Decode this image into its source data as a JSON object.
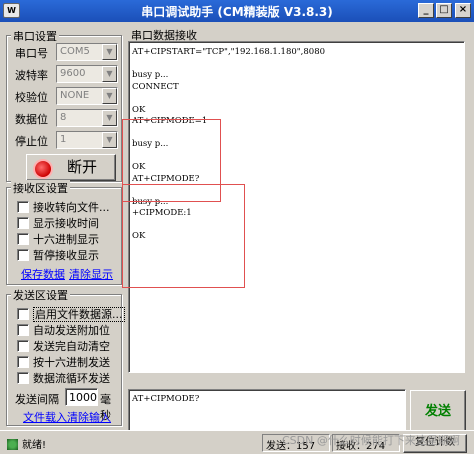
{
  "window": {
    "title": "串口调试助手 (CM精装版 V3.8.3)",
    "icon_label": "W",
    "minimize_glyph": "_",
    "maximize_glyph": "□",
    "close_glyph": "×"
  },
  "serial_settings": {
    "title": "串口设置",
    "port_label": "串口号",
    "port_value": "COM5",
    "baud_label": "波特率",
    "baud_value": "9600",
    "parity_label": "校验位",
    "parity_value": "NONE",
    "databits_label": "数据位",
    "databits_value": "8",
    "stopbits_label": "停止位",
    "stopbits_value": "1",
    "open_button": "断开",
    "dropdown_glyph": "▼"
  },
  "receive_settings": {
    "title": "接收区设置",
    "options": [
      "接收转向文件...",
      "显示接收时间",
      "十六进制显示",
      "暂停接收显示"
    ],
    "save_link": "保存数据",
    "clear_link": "清除显示"
  },
  "send_settings": {
    "title": "发送区设置",
    "options": [
      "启用文件数据源...",
      "自动发送附加位",
      "发送完自动清空",
      "按十六进制发送",
      "数据流循环发送"
    ],
    "interval_label": "发送间隔",
    "interval_value": "1000",
    "interval_unit": "毫秒",
    "load_file_link": "文件载入",
    "clear_input_link": "清除输入"
  },
  "receive_area": {
    "title": "串口数据接收",
    "lines": [
      "AT+CIPSTART=\"TCP\",\"192.168.1.180\",8080",
      "",
      "busy p...",
      "CONNECT",
      "",
      "OK",
      "AT+CIPMODE=1",
      "",
      "busy p...",
      "",
      "OK",
      "AT+CIPMODE?",
      "",
      "busy p...",
      "+CIPMODE:1",
      "",
      "OK"
    ]
  },
  "send_area": {
    "text": "AT+CIPMODE?",
    "send_button": "发送"
  },
  "statusbar": {
    "status": "就绪!",
    "sent": "发送：157",
    "received": "接收：274",
    "reset": "复位计数"
  },
  "watermark": "CSDN @什么时候能打下来这星期啊"
}
